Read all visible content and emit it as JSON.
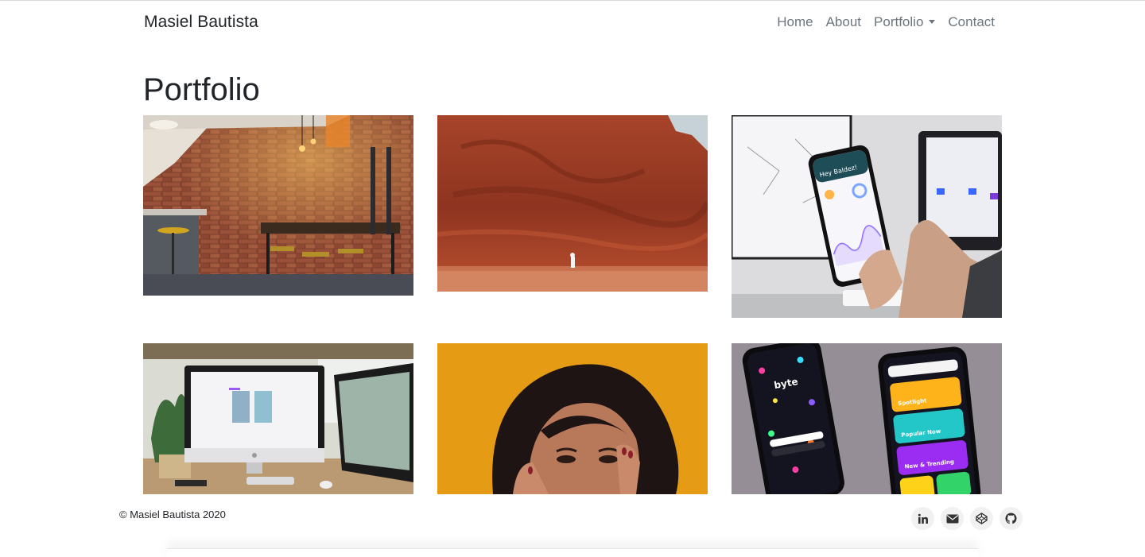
{
  "navbar": {
    "brand": "Masiel Bautista",
    "links": [
      "Home",
      "About",
      "Portfolio",
      "Contact"
    ]
  },
  "page": {
    "title": "Portfolio"
  },
  "portfolio": {
    "items": [
      {
        "subject": "brick-wall-kitchen-photo"
      },
      {
        "subject": "red-rock-cliff-photo"
      },
      {
        "subject": "phone-app-mockup-photo",
        "screen_text": "Hey Baldez!"
      },
      {
        "subject": "imac-desk-workspace-photo"
      },
      {
        "subject": "woman-portrait-orange-photo"
      },
      {
        "subject": "byte-app-phones-photo",
        "screen_text": [
          "byte",
          "Spotlight",
          "Popular Now",
          "New & Trending"
        ]
      }
    ]
  },
  "footer": {
    "copyright": "© Masiel Bautista 2020",
    "social_icons": [
      "linkedin-icon",
      "email-icon",
      "codepen-icon",
      "github-icon"
    ]
  },
  "colors": {
    "text": "#212529",
    "nav_link": "#6c757d",
    "social_bg": "#f1f1f1"
  }
}
